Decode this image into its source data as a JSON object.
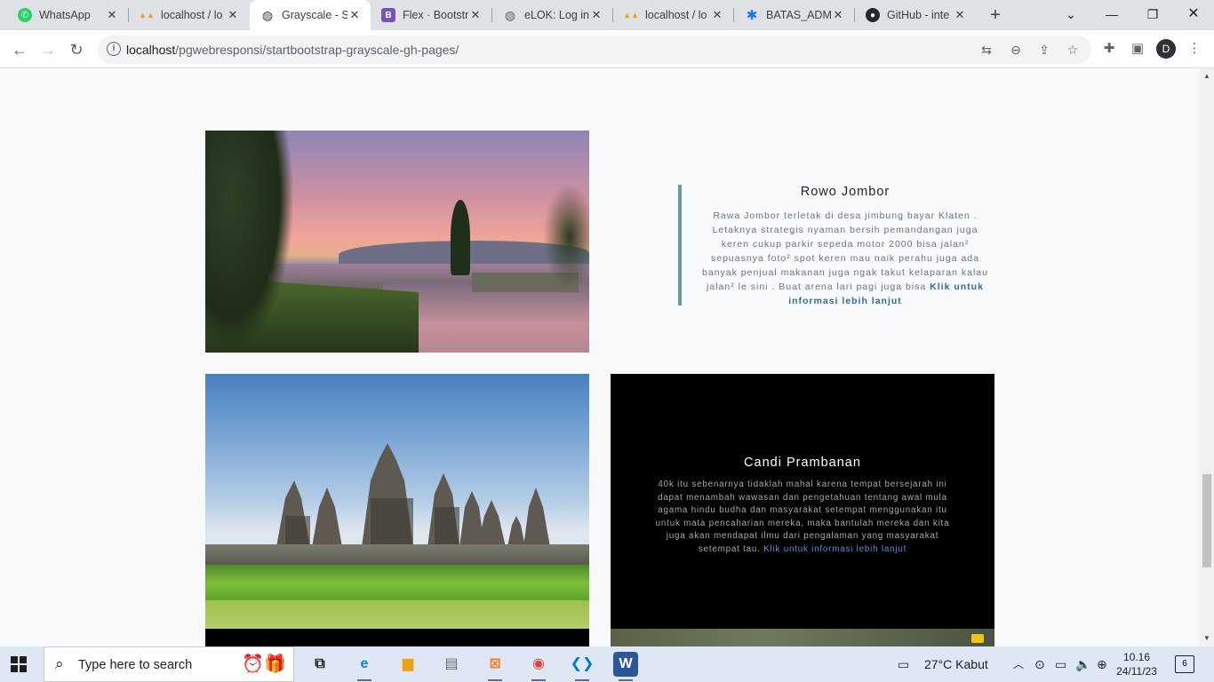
{
  "browser": {
    "tabs": [
      {
        "title": "WhatsApp",
        "icon": "whatsapp-icon",
        "color": "#25d366"
      },
      {
        "title": "localhost / lo",
        "icon": "phpmyadmin-icon",
        "color": "#f89c0e"
      },
      {
        "title": "Grayscale - S",
        "icon": "globe-icon",
        "color": "#3c4043"
      },
      {
        "title": "Flex · Bootstr",
        "icon": "bootstrap-icon",
        "color": "#7952b3"
      },
      {
        "title": "eLOK: Log in",
        "icon": "globe-icon",
        "color": "#5f6368"
      },
      {
        "title": "localhost / lo",
        "icon": "phpmyadmin-icon",
        "color": "#f89c0e"
      },
      {
        "title": "BATAS_ADMI",
        "icon": "asterisk-icon",
        "color": "#1a73e8"
      },
      {
        "title": "GitHub - inte",
        "icon": "github-icon",
        "color": "#24292f"
      }
    ],
    "active_tab": 2,
    "url_host": "localhost",
    "url_path": "/pgwebresponsi/startbootstrap-grayscale-gh-pages/",
    "profile_initial": "D"
  },
  "page": {
    "project1": {
      "title": "Rowo Jombor",
      "description": "Rawa Jombor terletak di desa jimbung bayar Klaten . Letaknya strategis nyaman bersih pemandangan juga keren cukup parkir sepeda motor 2000 bisa jalan² sepuasnya foto² spot keren mau naik perahu juga ada banyak penjual makanan juga ngak takut kelaparan kalau jalan² le sini . Buat arena lari pagi juga bisa",
      "link": "Klik untuk informasi lebih lanjut"
    },
    "project2": {
      "title": "Candi Prambanan",
      "description": "40k itu sebenarnya tidaklah mahal karena tempat bersejarah ini dapat menambah wawasan dan pengetahuan tentang awal mula agama hindu budha dan masyarakat setempat menggunakan itu untuk mata pencaharian mereka, maka bantulah mereka dan kita juga akan mendapat ilmu dari pengalaman yang masyarakat setempat tau.",
      "link": "Klik untuk informasi lebih lanjut"
    },
    "accent_color": "#64a19d"
  },
  "taskbar": {
    "search_placeholder": "Type here to search",
    "weather": "27°C  Kabut",
    "time": "10.16",
    "date": "24/11/23",
    "notifications": "6"
  }
}
